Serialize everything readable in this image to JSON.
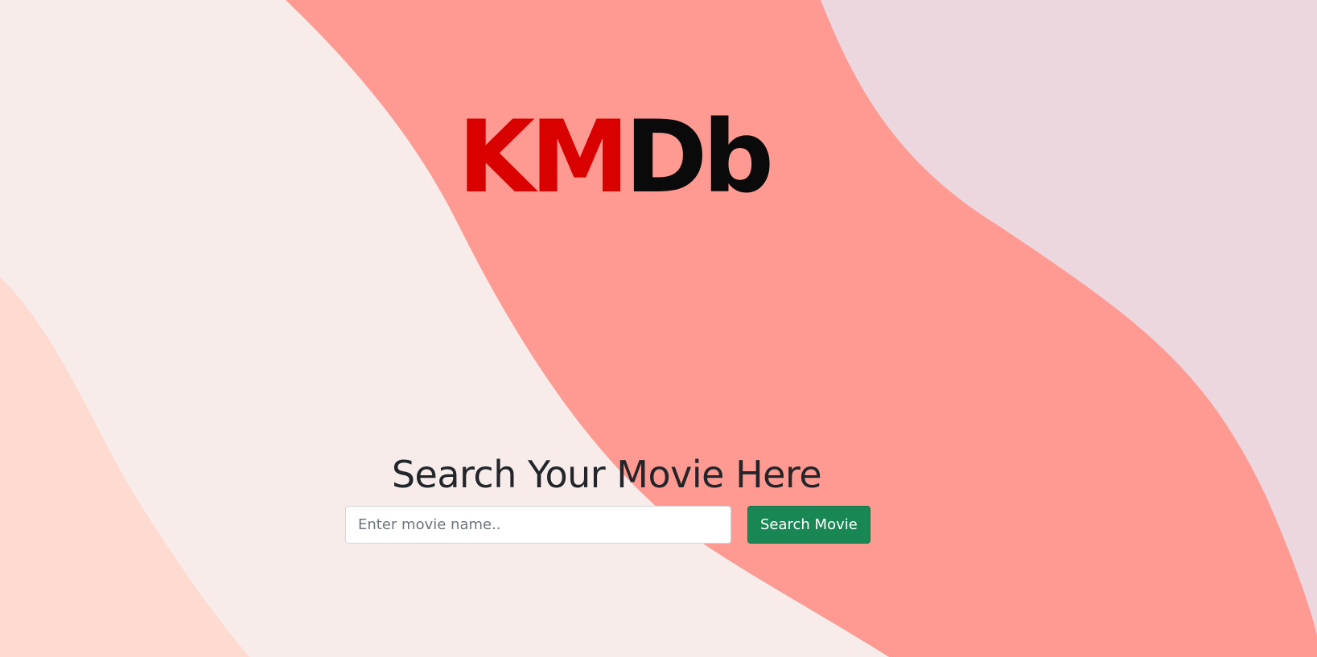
{
  "logo": {
    "red_part": "KM",
    "black_part": "Db",
    "red_color": "#d90000",
    "black_color": "#0a0a0a"
  },
  "search": {
    "heading": "Search Your Movie Here",
    "placeholder": "Enter movie name..",
    "value": "",
    "button_label": "Search Movie",
    "button_color": "#198754"
  },
  "background": {
    "colors": [
      "#f7ecea",
      "#fe9a92",
      "#ebd7dd",
      "#fedad0"
    ]
  }
}
